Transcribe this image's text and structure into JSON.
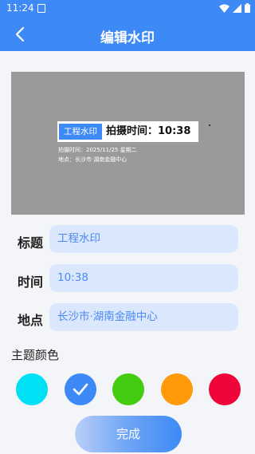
{
  "status_bar": {
    "time": "11:24"
  },
  "header": {
    "title": "编辑水印"
  },
  "watermark": {
    "title": "工程水印",
    "time_label": "拍摄时间：",
    "time_value": "10:38",
    "date_line": "拍摄时间：2025/11/25 星期二",
    "location_line": "地点：长沙市·湖南金融中心"
  },
  "form": {
    "title_label": "标题",
    "title_value": "工程水印",
    "time_label": "时间",
    "time_value": "10:38",
    "location_label": "地点",
    "location_value": "长沙市·湖南金融中心"
  },
  "theme": {
    "label": "主题颜色",
    "colors": [
      "#00e0f5",
      "#3d8af7",
      "#44cc11",
      "#ff9a0a",
      "#f0053b"
    ],
    "selected_index": 1
  },
  "done_label": "完成"
}
